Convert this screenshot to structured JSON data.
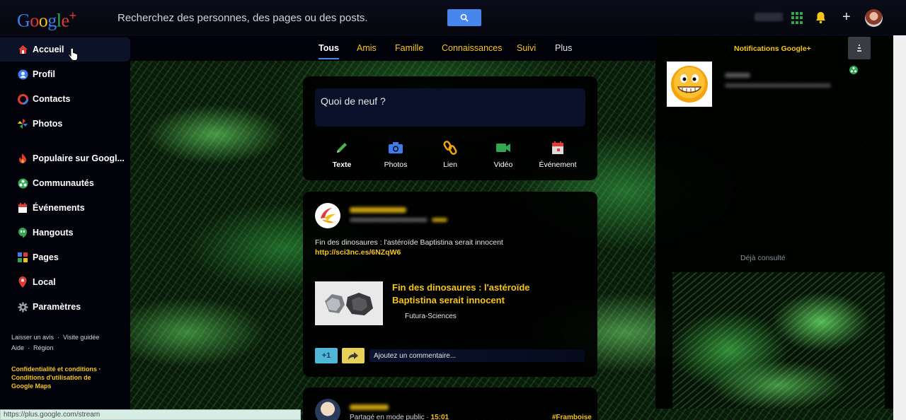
{
  "topbar": {
    "logo_letters": [
      "G",
      "o",
      "o",
      "g",
      "l",
      "e",
      "+"
    ],
    "search_placeholder": "Recherchez des personnes, des pages ou des posts.",
    "colors": {
      "search_button": "#4787ed",
      "accent_yellow": "#f5c518"
    }
  },
  "sidebar": {
    "items": [
      {
        "label": "Accueil",
        "icon": "home-icon",
        "active": true
      },
      {
        "label": "Profil",
        "icon": "profile-icon"
      },
      {
        "label": "Contacts",
        "icon": "contacts-icon"
      },
      {
        "label": "Photos",
        "icon": "photos-icon"
      },
      {
        "label": "Populaire sur Googl...",
        "icon": "flame-icon"
      },
      {
        "label": "Communautés",
        "icon": "communities-icon"
      },
      {
        "label": "Événements",
        "icon": "calendar-icon"
      },
      {
        "label": "Hangouts",
        "icon": "hangouts-icon"
      },
      {
        "label": "Pages",
        "icon": "pages-icon"
      },
      {
        "label": "Local",
        "icon": "location-pin-icon"
      },
      {
        "label": "Paramètres",
        "icon": "gear-icon"
      }
    ],
    "footer": {
      "feedback": "Laisser un avis",
      "tour": "Visite guidée",
      "help": "Aide",
      "region": "Région",
      "legal_line1": "Confidentialité et conditions",
      "legal_line2": "Conditions d'utilisation de",
      "legal_line3": "Google Maps"
    }
  },
  "tabs": [
    {
      "label": "Tous",
      "active": true
    },
    {
      "label": "Amis"
    },
    {
      "label": "Famille"
    },
    {
      "label": "Connaissances"
    },
    {
      "label": "Suivi"
    },
    {
      "label": "Plus"
    }
  ],
  "composer": {
    "prompt": "Quoi de neuf ?",
    "actions": [
      {
        "label": "Texte",
        "icon": "pencil-icon",
        "color": "#4caf50"
      },
      {
        "label": "Photos",
        "icon": "camera-icon",
        "color": "#3b7ded"
      },
      {
        "label": "Lien",
        "icon": "link-icon",
        "color": "#f4a30d"
      },
      {
        "label": "Vidéo",
        "icon": "video-icon",
        "color": "#2fa84f"
      },
      {
        "label": "Événement",
        "icon": "calendar-icon",
        "color": "#e53935"
      }
    ]
  },
  "post": {
    "text": "Fin des dinosaures : l'astéroïde Baptistina serait innocent",
    "link_url": "http://sci3nc.es/6NZqW6",
    "link_title": "Fin des dinosaures : l'astéroïde Baptistina serait innocent",
    "link_source": "Futura-Sciences",
    "plus_one": "+1",
    "comment_placeholder": "Ajoutez un commentaire..."
  },
  "post2": {
    "visibility": "Partagé en mode public",
    "separator": "·",
    "time": "15:01",
    "hashtag": "#Framboise"
  },
  "notifications": {
    "title": "Notifications Google+",
    "seen_label": "Déjà consulté"
  },
  "statusbar": {
    "url": "https://plus.google.com/stream"
  }
}
